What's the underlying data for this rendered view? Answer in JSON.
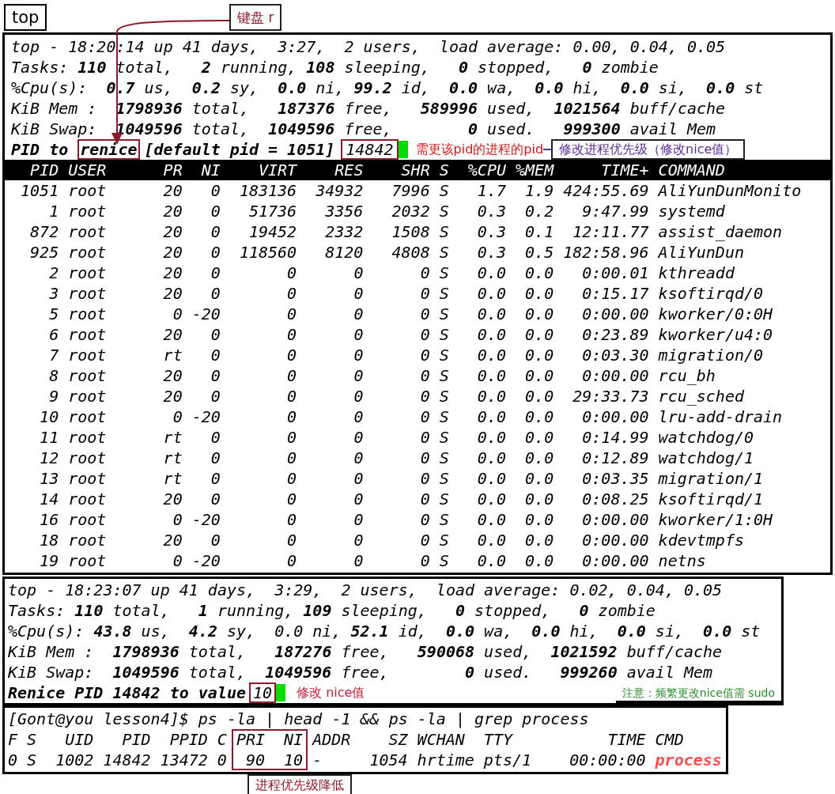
{
  "tab_label": "top",
  "first_screen": {
    "summary_lines": [
      "top - 18:20:14 up 41 days,  3:27,  2 users,  load average: 0.00, 0.04, 0.05",
      "Tasks: **110** total,   **2** running, **108** sleeping,   **0** stopped,   **0** zombie",
      "%Cpu(s):  **0.7** us,  **0.2** sy,  **0.0** ni, **99.2** id,  **0.0** wa,  **0.0** hi,  **0.0** si,  **0.0** st",
      "KiB Mem :  **1798936** total,   **187376** free,   **589996** used,  **1021564** buff/cache",
      "KiB Swap:  **1049596** total,  **1049596** free,        **0** used.   **999300** avail Mem"
    ],
    "prompt": {
      "prefix": "PID to",
      "keyword": "renice",
      "suffix": "[default pid = 1051]",
      "input": "14842"
    },
    "columns": [
      "PID",
      "USER",
      "PR",
      "NI",
      "VIRT",
      "RES",
      "SHR",
      "S",
      "%CPU",
      "%MEM",
      "TIME+",
      "COMMAND"
    ],
    "rows": [
      [
        "1051",
        "root",
        "20",
        "0",
        "183136",
        "34932",
        "7996",
        "S",
        "1.7",
        "1.9",
        "424:55.69",
        "AliYunDunMonito"
      ],
      [
        "1",
        "root",
        "20",
        "0",
        "51736",
        "3356",
        "2032",
        "S",
        "0.3",
        "0.2",
        "9:47.99",
        "systemd"
      ],
      [
        "872",
        "root",
        "20",
        "0",
        "19452",
        "2332",
        "1508",
        "S",
        "0.3",
        "0.1",
        "12:11.77",
        "assist_daemon"
      ],
      [
        "925",
        "root",
        "20",
        "0",
        "118560",
        "8120",
        "4808",
        "S",
        "0.3",
        "0.5",
        "182:58.96",
        "AliYunDun"
      ],
      [
        "2",
        "root",
        "20",
        "0",
        "0",
        "0",
        "0",
        "S",
        "0.0",
        "0.0",
        "0:00.01",
        "kthreadd"
      ],
      [
        "3",
        "root",
        "20",
        "0",
        "0",
        "0",
        "0",
        "S",
        "0.0",
        "0.0",
        "0:15.17",
        "ksoftirqd/0"
      ],
      [
        "5",
        "root",
        "0",
        "-20",
        "0",
        "0",
        "0",
        "S",
        "0.0",
        "0.0",
        "0:00.00",
        "kworker/0:0H"
      ],
      [
        "6",
        "root",
        "20",
        "0",
        "0",
        "0",
        "0",
        "S",
        "0.0",
        "0.0",
        "0:23.89",
        "kworker/u4:0"
      ],
      [
        "7",
        "root",
        "rt",
        "0",
        "0",
        "0",
        "0",
        "S",
        "0.0",
        "0.0",
        "0:03.30",
        "migration/0"
      ],
      [
        "8",
        "root",
        "20",
        "0",
        "0",
        "0",
        "0",
        "S",
        "0.0",
        "0.0",
        "0:00.00",
        "rcu_bh"
      ],
      [
        "9",
        "root",
        "20",
        "0",
        "0",
        "0",
        "0",
        "S",
        "0.0",
        "0.0",
        "29:33.73",
        "rcu_sched"
      ],
      [
        "10",
        "root",
        "0",
        "-20",
        "0",
        "0",
        "0",
        "S",
        "0.0",
        "0.0",
        "0:00.00",
        "lru-add-drain"
      ],
      [
        "11",
        "root",
        "rt",
        "0",
        "0",
        "0",
        "0",
        "S",
        "0.0",
        "0.0",
        "0:14.99",
        "watchdog/0"
      ],
      [
        "12",
        "root",
        "rt",
        "0",
        "0",
        "0",
        "0",
        "S",
        "0.0",
        "0.0",
        "0:12.89",
        "watchdog/1"
      ],
      [
        "13",
        "root",
        "rt",
        "0",
        "0",
        "0",
        "0",
        "S",
        "0.0",
        "0.0",
        "0:03.35",
        "migration/1"
      ],
      [
        "14",
        "root",
        "20",
        "0",
        "0",
        "0",
        "0",
        "S",
        "0.0",
        "0.0",
        "0:08.25",
        "ksoftirqd/1"
      ],
      [
        "16",
        "root",
        "0",
        "-20",
        "0",
        "0",
        "0",
        "S",
        "0.0",
        "0.0",
        "0:00.00",
        "kworker/1:0H"
      ],
      [
        "18",
        "root",
        "20",
        "0",
        "0",
        "0",
        "0",
        "S",
        "0.0",
        "0.0",
        "0:00.00",
        "kdevtmpfs"
      ],
      [
        "19",
        "root",
        "0",
        "-20",
        "0",
        "0",
        "0",
        "S",
        "0.0",
        "0.0",
        "0:00.00",
        "netns"
      ]
    ]
  },
  "second_screen": {
    "summary_lines": [
      "top - 18:23:07 up 41 days,  3:29,  2 users,  load average: 0.02, 0.04, 0.05",
      "Tasks: **110** total,   **1** running, **109** sleeping,   **0** stopped,   **0** zombie",
      "%Cpu(s): **43.8** us,  **4.2** sy,  0.0 ni, **52.1** id,  **0.0** wa,  **0.0** hi,  **0.0** si,  **0.0** st",
      "KiB Mem :  **1798936** total,   **187276** free,   **590068** used,  **1021592** buff/cache",
      "KiB Swap:  **1049596** total,  **1049596** free,        **0** used.   **999260** avail Mem"
    ],
    "prompt": {
      "text": "Renice PID 14842 to value",
      "input": "10"
    }
  },
  "ps_output": {
    "command": "[Gont@you lesson4]$ ps -la | head -1 && ps -la | grep process",
    "columns": [
      {
        "label": "F",
        "boxed": false
      },
      {
        "label": "S",
        "boxed": false
      },
      {
        "label": "UID",
        "boxed": false
      },
      {
        "label": "PID",
        "boxed": false
      },
      {
        "label": "PPID",
        "boxed": false
      },
      {
        "label": "C",
        "boxed": false
      },
      {
        "label": "PRI",
        "boxed": true
      },
      {
        "label": "NI",
        "boxed": true
      },
      {
        "label": "ADDR",
        "boxed": false
      },
      {
        "label": "SZ",
        "boxed": false
      },
      {
        "label": "WCHAN",
        "boxed": false
      },
      {
        "label": "TTY",
        "boxed": false
      },
      {
        "label": "TIME",
        "boxed": false
      },
      {
        "label": "CMD",
        "boxed": false
      }
    ],
    "row": [
      "0",
      "S",
      "1002",
      "14842",
      "13472",
      "0",
      "90",
      "10",
      "-",
      "1054",
      "hrtime",
      "pts/1",
      "00:00:00",
      "process"
    ]
  },
  "annotations": {
    "keyboard_hint": "键盘 r",
    "pid_hint": "需更该pid的进程的pid",
    "purpose": "修改进程优先级（修改nice值）",
    "nice_hint": "修改 nice值",
    "sudo_note": "注意：频繁更改nice值需 sudo",
    "result": "进程优先级降低"
  }
}
